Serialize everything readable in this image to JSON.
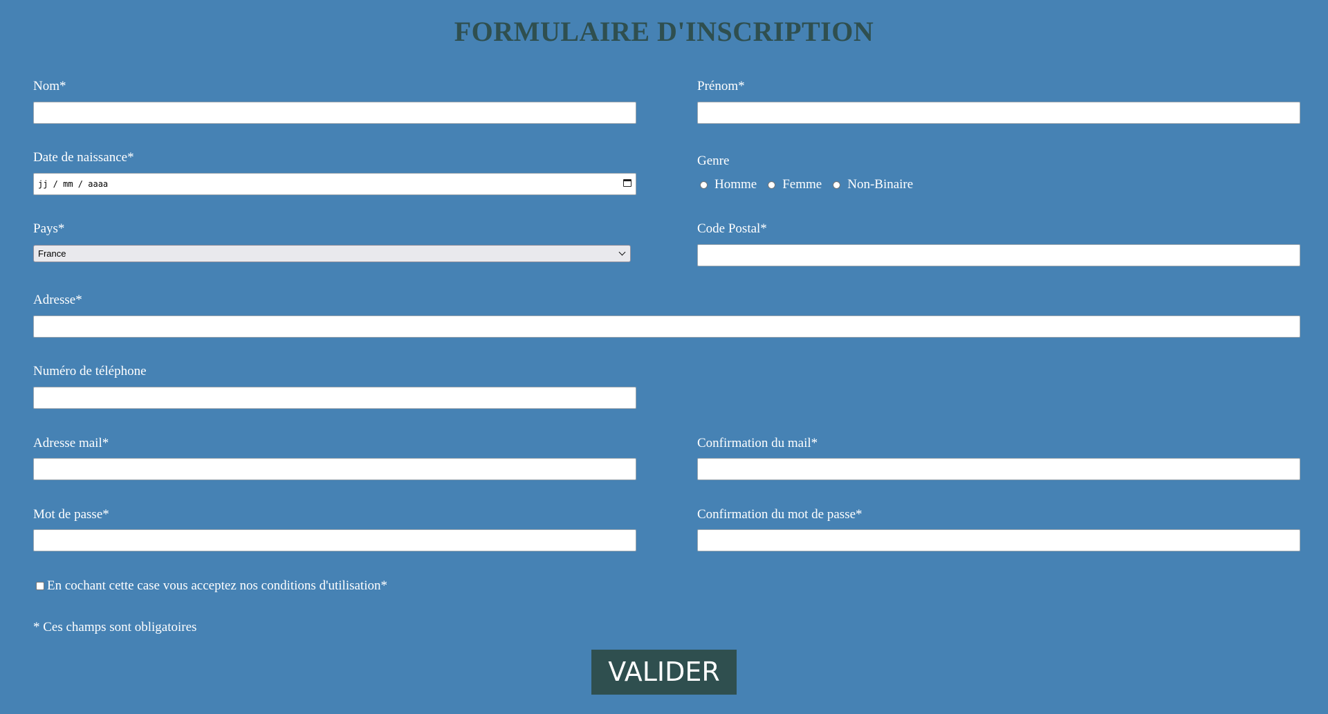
{
  "form": {
    "title": "FORMULAIRE D'INSCRIPTION",
    "nom_label": "Nom*",
    "prenom_label": "Prénom*",
    "birthdate_label": "Date de naissance*",
    "birthdate_placeholder": "jj / mm / aaaa",
    "genre_label": "Genre",
    "genre_options": [
      "Homme",
      "Femme",
      "Non-Binaire"
    ],
    "pays_label": "Pays*",
    "pays_selected": "France",
    "code_postal_label": "Code Postal*",
    "adresse_label": "Adresse*",
    "telephone_label": "Numéro de téléphone",
    "email_label": "Adresse mail*",
    "email_confirm_label": "Confirmation du mail*",
    "password_label": "Mot de passe*",
    "password_confirm_label": "Confirmation du mot de passe*",
    "terms_label": "En cochant cette case vous acceptez nos conditions d'utilisation*",
    "required_note": "* Ces champs sont obligatoires",
    "submit_label": "VALIDER"
  },
  "colors": {
    "background": "#4682b4",
    "title": "#2f4f4f",
    "button": "#2f4f4f",
    "text": "#ffffff"
  },
  "icons": {
    "date_picker": "calendar-icon",
    "select": "chevron-down-icon"
  }
}
